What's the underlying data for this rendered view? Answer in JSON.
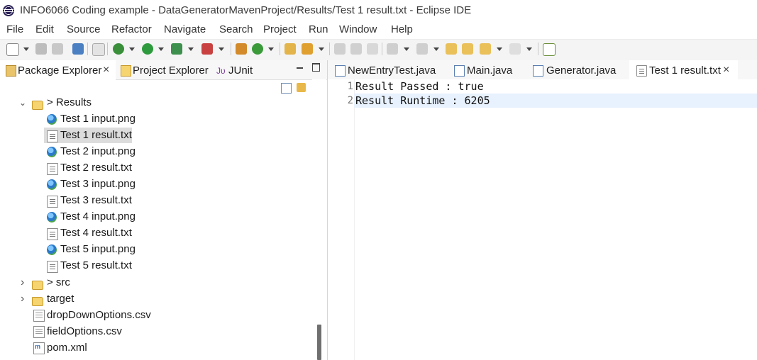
{
  "window": {
    "title": "INFO6066 Coding example - DataGeneratorMavenProject/Results/Test 1 result.txt - Eclipse IDE"
  },
  "menu": [
    "File",
    "Edit",
    "Source",
    "Refactor",
    "Navigate",
    "Search",
    "Project",
    "Run",
    "Window",
    "Help"
  ],
  "left_tabs": {
    "package_explorer": "Package Explorer",
    "project_explorer": "Project Explorer",
    "junit_prefix": "Jᴜ",
    "junit": "JUnit"
  },
  "tree": {
    "results_folder": "> Results",
    "results_items": [
      "Test 1 input.png",
      "Test 1 result.txt",
      "Test 2 input.png",
      "Test 2 result.txt",
      "Test 3 input.png",
      "Test 3 result.txt",
      "Test 4 input.png",
      "Test 4 result.txt",
      "Test 5 input.png",
      "Test 5 result.txt"
    ],
    "src_folder": "> src",
    "target_folder": "target",
    "files": [
      "dropDownOptions.csv",
      "fieldOptions.csv",
      "pom.xml"
    ]
  },
  "editor_tabs": [
    "NewEntryTest.java",
    "Main.java",
    "Generator.java",
    "Test 1 result.txt"
  ],
  "editor": {
    "line_numbers": [
      "1",
      "2"
    ],
    "lines": [
      "Result Passed : true",
      "Result Runtime : 6205"
    ]
  },
  "icons": {
    "close": "×",
    "chevron_down": "⌄",
    "chevron_right": "›",
    "view_menu": "⋮"
  }
}
